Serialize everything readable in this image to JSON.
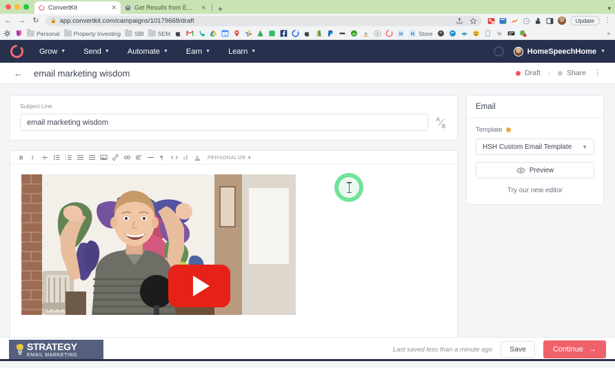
{
  "browser": {
    "tabs": [
      {
        "title": "ConvertKit",
        "favicon": "convertkit-icon",
        "active": true
      },
      {
        "title": "Get Results from Email Marketi",
        "favicon": "globe-icon",
        "active": false
      }
    ],
    "new_tab_label": "+",
    "nav": {
      "back": "←",
      "forward": "→",
      "reload": "↻"
    },
    "url": "app.convertkit.com/campaigns/10179668/draft",
    "url_lock": "lock-icon",
    "update_button": "Update",
    "omni_icons": [
      "share-icon",
      "bookmark-star-icon",
      "extension-red-icon",
      "extension-blue-icon",
      "extension-chart-icon",
      "extension-clock-icon",
      "puzzle-icon",
      "sidepanel-icon",
      "profile-avatar-icon"
    ],
    "bookmarks": [
      {
        "label": "",
        "icon": "gear-icon"
      },
      {
        "label": "",
        "icon": "pocket-icon"
      },
      {
        "label": "Personal",
        "icon": "folder-icon"
      },
      {
        "label": "Property Investing",
        "icon": "folder-icon"
      },
      {
        "label": "SBI",
        "icon": "folder-icon"
      },
      {
        "label": "SEM",
        "icon": "folder-icon"
      },
      {
        "label": "",
        "icon": "apple-icon"
      },
      {
        "label": "",
        "icon": "gmail-icon"
      },
      {
        "label": "",
        "icon": "phone-icon"
      },
      {
        "label": "",
        "icon": "google-drive-icon"
      },
      {
        "label": "",
        "icon": "google-calendar-icon"
      },
      {
        "label": "",
        "icon": "google-maps-icon"
      },
      {
        "label": "",
        "icon": "google-photos-icon"
      },
      {
        "label": "",
        "icon": "google-analytics-icon"
      },
      {
        "label": "",
        "icon": "evernote-icon"
      },
      {
        "label": "",
        "icon": "facebook-icon"
      },
      {
        "label": "",
        "icon": "convertkit-icon"
      },
      {
        "label": "",
        "icon": "apple-icon"
      },
      {
        "label": "",
        "icon": "shopify-icon"
      },
      {
        "label": "",
        "icon": "paypal-icon"
      },
      {
        "label": "",
        "icon": "dash-icon"
      },
      {
        "label": "",
        "icon": "quickbooks-icon"
      },
      {
        "label": "",
        "icon": "amazon-icon"
      },
      {
        "label": "",
        "icon": "dollar-icon"
      },
      {
        "label": "",
        "icon": "convertkit-red-icon"
      },
      {
        "label": "",
        "icon": "h-blue-icon"
      },
      {
        "label": "Store",
        "icon": "h-blue-icon"
      },
      {
        "label": "",
        "icon": "dark-avatar-icon"
      },
      {
        "label": "",
        "icon": "edge-icon"
      },
      {
        "label": "",
        "icon": "wave-icon"
      },
      {
        "label": "",
        "icon": "smiley-icon"
      },
      {
        "label": "",
        "icon": "clipboard-icon"
      },
      {
        "label": "",
        "icon": "w-icon"
      },
      {
        "label": "",
        "icon": "keyboard-icon"
      },
      {
        "label": "",
        "icon": "red-badge-icon"
      }
    ],
    "bookmarks_overflow": "»"
  },
  "topnav": {
    "logo": "convertkit-logo",
    "items": [
      {
        "label": "Grow"
      },
      {
        "label": "Send"
      },
      {
        "label": "Automate"
      },
      {
        "label": "Earn"
      },
      {
        "label": "Learn"
      }
    ],
    "loading_indicator": "spinner-ring-icon",
    "account": "HomeSpeechHome"
  },
  "subheader": {
    "back": "←",
    "title": "email marketing wisdom",
    "status": "Draft",
    "step_separator": "›",
    "share": "Share",
    "menu": "⋮"
  },
  "subject": {
    "label": "Subject Line",
    "value": "email marketing wisdom",
    "placeholder": "Subject Line",
    "ab_test": "A/B"
  },
  "toolbar": {
    "buttons": [
      {
        "name": "bold-icon",
        "glyph": "B"
      },
      {
        "name": "italic-icon",
        "glyph": "I"
      },
      {
        "name": "strikethrough-icon",
        "glyph": "S"
      },
      {
        "name": "bulleted-list-icon",
        "glyph": "☰"
      },
      {
        "name": "numbered-list-icon",
        "glyph": "☰"
      },
      {
        "name": "outdent-icon",
        "glyph": "☰"
      },
      {
        "name": "indent-icon",
        "glyph": "☰"
      },
      {
        "name": "image-icon",
        "glyph": "▣"
      },
      {
        "name": "link-icon",
        "glyph": "🔗"
      },
      {
        "name": "unlink-icon",
        "glyph": "∞"
      },
      {
        "name": "align-icon",
        "glyph": "≡"
      },
      {
        "name": "horizontal-rule-icon",
        "glyph": "—"
      },
      {
        "name": "paragraph-icon",
        "glyph": "¶"
      },
      {
        "name": "code-icon",
        "glyph": "<>"
      },
      {
        "name": "clear-format-icon",
        "glyph": "A"
      },
      {
        "name": "text-color-icon",
        "glyph": "A"
      }
    ],
    "personalize_label": "PERSONALIZE"
  },
  "editor_body": {
    "video_alt": "youtube-video-thumbnail",
    "play_button": "youtube-play-icon"
  },
  "cursor": {
    "type": "i-beam-cursor",
    "highlight_color": "#6fe39a"
  },
  "sidebar": {
    "heading": "Email",
    "template_label": "Template",
    "template_warning": "warning-dot",
    "template_value": "HSH Custom Email Template",
    "preview_label": "Preview",
    "preview_icon": "eye-icon",
    "new_editor_link": "Try our new editor"
  },
  "footer": {
    "brand_line1": "STRATEGY",
    "brand_line2": "EMAIL MARKETING",
    "brand_icon": "lightbulb-icon",
    "saved_text": "Last saved less than a minute ago",
    "save_label": "Save",
    "continue_label": "Continue",
    "continue_arrow": "→"
  },
  "colors": {
    "brand_red": "#f0626a",
    "navy": "#27314e",
    "draft_red": "#f0545b",
    "warning_orange": "#efab40",
    "tabstrip_green": "#c9e3b4"
  }
}
